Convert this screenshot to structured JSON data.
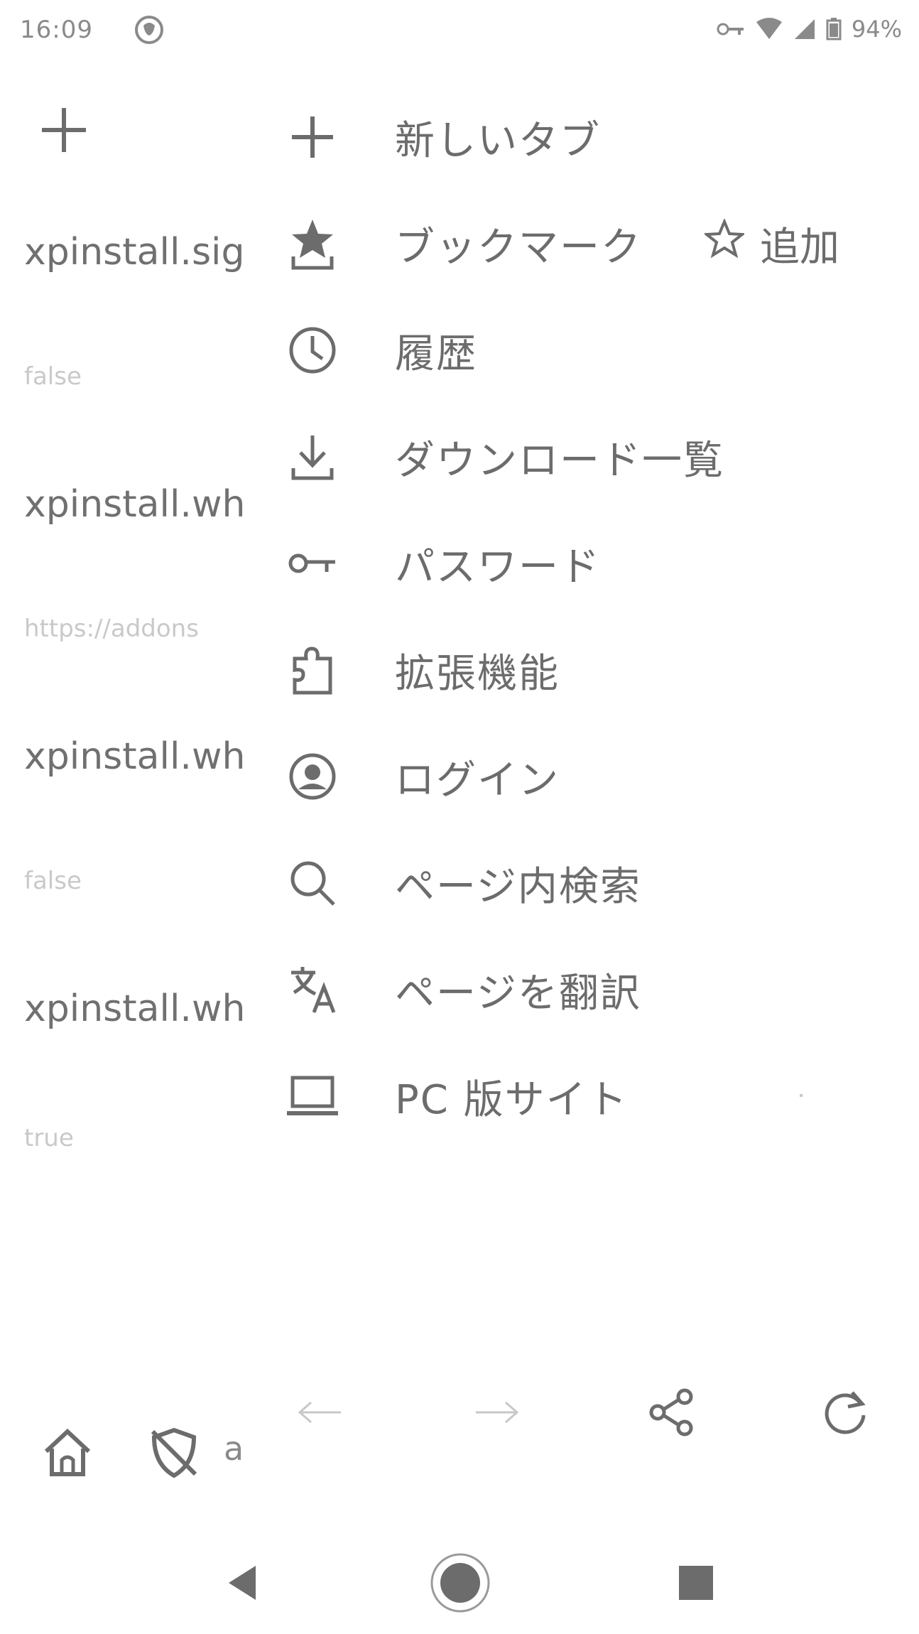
{
  "status_bar": {
    "time": "16:09",
    "battery": "94%"
  },
  "background_page": {
    "rows": [
      {
        "text": "xpinstall.sig",
        "kind": "key"
      },
      {
        "text": "false",
        "kind": "value"
      },
      {
        "text": "xpinstall.wh",
        "kind": "key"
      },
      {
        "text": "https://addons",
        "kind": "value"
      },
      {
        "text": "xpinstall.wh",
        "kind": "key"
      },
      {
        "text": "false",
        "kind": "value"
      },
      {
        "text": "xpinstall.wh",
        "kind": "key"
      },
      {
        "text": "true",
        "kind": "value"
      }
    ],
    "bottom_partial_text": "a"
  },
  "menu": {
    "items": [
      {
        "label": "新しいタブ",
        "icon": "plus-icon"
      },
      {
        "label": "ブックマーク",
        "icon": "bookmark-icon",
        "extra_label": "追加",
        "extra_icon": "star-outline-icon"
      },
      {
        "label": "履歴",
        "icon": "clock-icon"
      },
      {
        "label": "ダウンロード一覧",
        "icon": "download-icon"
      },
      {
        "label": "パスワード",
        "icon": "key-icon"
      },
      {
        "label": "拡張機能",
        "icon": "puzzle-icon"
      },
      {
        "label": "ログイン",
        "icon": "account-icon"
      },
      {
        "label": "ページ内検索",
        "icon": "search-icon"
      },
      {
        "label": "ページを翻訳",
        "icon": "translate-icon"
      },
      {
        "label": "PC 版サイト",
        "icon": "laptop-icon"
      }
    ],
    "bottom_actions": [
      {
        "name": "back",
        "icon": "arrow-left-icon",
        "enabled": false
      },
      {
        "name": "forward",
        "icon": "arrow-right-icon",
        "enabled": false
      },
      {
        "name": "share",
        "icon": "share-icon",
        "enabled": true
      },
      {
        "name": "reload",
        "icon": "reload-icon",
        "enabled": true
      }
    ]
  },
  "colors": {
    "icon": "#6c6c6c",
    "disabled": "#c8c8c8",
    "faded_text": "#c9c9c9"
  }
}
